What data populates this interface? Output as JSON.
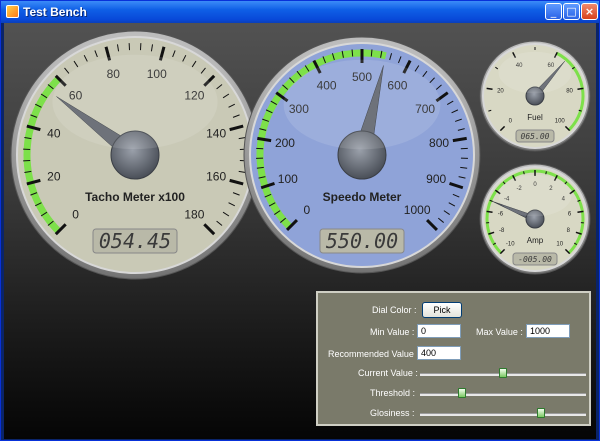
{
  "window": {
    "title": "Test Bench"
  },
  "titlebar_buttons": {
    "minimize": "_",
    "maximize": "□",
    "close": "×"
  },
  "gauges": [
    {
      "id": "tacho",
      "label": "Tacho Meter x100",
      "min": 0,
      "max": 180,
      "value": 54.45,
      "display": "054.45",
      "ticks": [
        "0",
        "20",
        "40",
        "60",
        "80",
        "100",
        "120",
        "140",
        "160",
        "180"
      ],
      "face_color": "#c9c9b6",
      "green_range": [
        0,
        60
      ]
    },
    {
      "id": "speedo",
      "label": "Speedo Meter",
      "min": 0,
      "max": 1000,
      "value": 550,
      "display": "550.00",
      "ticks": [
        "0",
        "100",
        "200",
        "300",
        "400",
        "500",
        "600",
        "700",
        "800",
        "900",
        "1000"
      ],
      "face_color": "#8fa3d8",
      "green_range": [
        0,
        550
      ]
    },
    {
      "id": "fuel",
      "label": "Fuel",
      "min": 0,
      "max": 100,
      "value": 65,
      "display": "065.00",
      "ticks": [
        "0",
        "20",
        "40",
        "60",
        "80",
        "100"
      ],
      "face_color": "#d8d8c4",
      "green_range": [
        60,
        100
      ]
    },
    {
      "id": "amp",
      "label": "Amp",
      "min": -10,
      "max": 10,
      "value": -5,
      "display": "-005.00",
      "ticks": [
        "-10",
        "-8",
        "-6",
        "-4",
        "-2",
        "0",
        "2",
        "4",
        "6",
        "8",
        "10"
      ],
      "face_color": "#d8d8c4",
      "green_range": [
        -10,
        10
      ]
    }
  ],
  "controls": {
    "dial_color_label": "Dial Color :",
    "pick_label": "Pick",
    "min_value_label": "Min Value :",
    "min_value": "0",
    "max_value_label": "Max Value :",
    "max_value": "1000",
    "recommended_label": "Recommended Value :",
    "recommended_value": "400",
    "current_label": "Current Value :",
    "current_fraction": 0.5,
    "threshold_label": "Threshold :",
    "threshold_fraction": 0.25,
    "glossiness_label": "Glosiness :",
    "glossiness_fraction": 0.73
  },
  "colors": {
    "accent_green": "#7de04a",
    "needle": "#5a5f68",
    "lcd_bg": "#b9b9a8",
    "lcd_text": "#3a3a3a"
  }
}
